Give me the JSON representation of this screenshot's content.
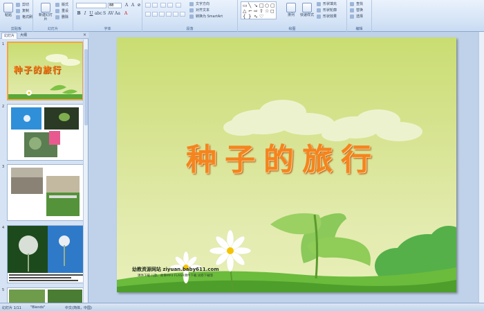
{
  "ribbon": {
    "groups": {
      "clipboard": "剪贴板",
      "slides": "幻灯片",
      "font": "字体",
      "paragraph": "段落",
      "drawing": "绘图",
      "editing": "编辑"
    },
    "clipboard": {
      "paste": "粘贴",
      "cut": "剪切",
      "copy": "复制",
      "format_painter": "格式刷"
    },
    "slides": {
      "new_slide": "新建幻灯片",
      "layout": "版式",
      "reset": "重设",
      "delete": "删除"
    },
    "font": {
      "font_name": "",
      "font_size": "88"
    },
    "paragraph": {
      "text_direction": "文字方向",
      "align_text": "对齐文本",
      "smartart": "转换为 SmartArt"
    },
    "drawing": {
      "arrange": "排列",
      "quick_styles": "快速样式",
      "shape_fill": "形状填充",
      "shape_outline": "形状轮廓",
      "shape_effects": "形状效果"
    },
    "editing": {
      "find": "查找",
      "replace": "替换",
      "select": "选择"
    }
  },
  "left_pane": {
    "tabs": [
      "幻灯片",
      "大纲"
    ],
    "close_glyph": "×",
    "thumbnails": [
      {
        "number": "1",
        "title": "种子的旅行"
      },
      {
        "number": "2",
        "caption": ""
      },
      {
        "number": "3",
        "caption": ""
      },
      {
        "number": "4",
        "caption": ""
      },
      {
        "number": "5",
        "caption": ""
      }
    ]
  },
  "slide": {
    "title": "种子的旅行",
    "brand": "幼教资源网站 ziyuan.baby611.com",
    "brand_sub": "课件下载   儿歌、故事MP3   FLASH课件下载   试卷下载等"
  },
  "status": {
    "slide_index": "幻灯片 1/11",
    "theme": "\"Blends\"",
    "language": "中文(简体，中国)"
  },
  "colors": {
    "title": "#f5841f",
    "slide_bg": "#d6e38f",
    "ribbon": "#d4e3f6",
    "selected_thumb_border": "#f3a541"
  }
}
